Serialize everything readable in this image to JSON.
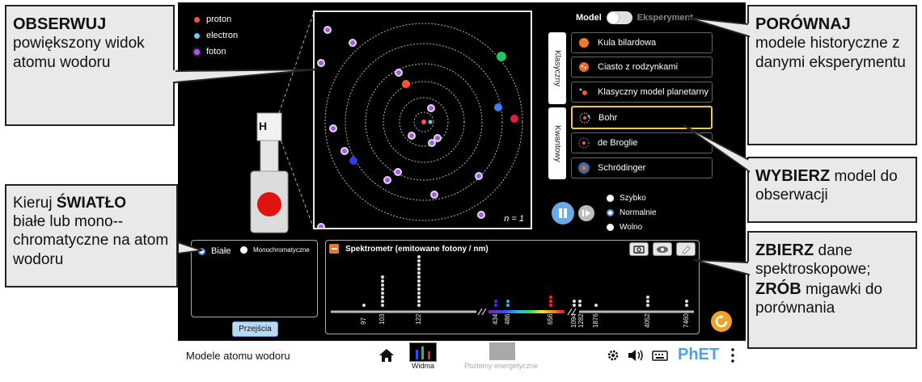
{
  "callouts": {
    "observe": {
      "bold": "OBSERWUJ",
      "text": "powiększony widok atomu wodoru"
    },
    "compare": {
      "bold": "PORÓWNAJ",
      "text": "modele historyczne z danymi eksperymentu"
    },
    "select": {
      "bold": "WYBIERZ",
      "text": "model do obserwacji"
    },
    "light": {
      "pre": "Kieruj",
      "bold": "ŚWIATŁO",
      "text": "białe lub mono--chromatyczne na atom wodoru"
    },
    "collect": {
      "bold1": "ZBIERZ",
      "text1": "dane spektroskopowe;",
      "bold2": "ZRÓB",
      "text2": "migawki do porównania"
    }
  },
  "legend": {
    "proton": "proton",
    "electron": "electron",
    "photon": "foton"
  },
  "atom_view": {
    "n_label": "n = 1"
  },
  "gun": {
    "label": "H"
  },
  "mode_toggle": {
    "left": "Model",
    "right": "Eksperyment"
  },
  "tabs": {
    "classical": "Klasyczny",
    "quantum": "Kwantowy"
  },
  "models": [
    {
      "label": "Kula bilardowa",
      "icon": "billiard-ball-icon",
      "selected": false
    },
    {
      "label": "Ciasto z rodzynkami",
      "icon": "plum-pudding-icon",
      "selected": false
    },
    {
      "label": "Klasyczny model planetarny",
      "icon": "planetary-icon",
      "selected": false
    },
    {
      "label": "Bohr",
      "icon": "bohr-icon",
      "selected": true
    },
    {
      "label": "de Broglie",
      "icon": "de-broglie-icon",
      "selected": false
    },
    {
      "label": "Schrödinger",
      "icon": "schrodinger-icon",
      "selected": false
    }
  ],
  "speed": {
    "fast": "Szybko",
    "normal": "Normalnie",
    "slow": "Wolno",
    "selected": "normal"
  },
  "light": {
    "white": "Białe",
    "mono": "Monochromatyczne",
    "selected": "white"
  },
  "transitions_button": "Przejścia",
  "spectrometer": {
    "title": "Spektrometr (emitowane fotony / nm)"
  },
  "spectrum_ticks": [
    "97",
    "103",
    "122",
    "434",
    "486",
    "656",
    "1094",
    "1282",
    "1876",
    "4052",
    "7460"
  ],
  "navbar": {
    "title": "Modele atomu wodoru",
    "screen1": "Widma",
    "screen2": "Poziomy energetyczne",
    "brand": "PhET"
  },
  "colors": {
    "photon_violet": "#a855f7",
    "proton": "#ff5533",
    "electron": "#66ccff",
    "selected_border": "#f2c94c",
    "reset": "#f0a22b"
  }
}
